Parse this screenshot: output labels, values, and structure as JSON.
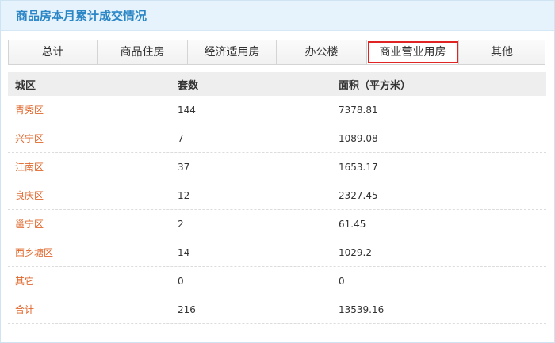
{
  "header": {
    "title": "商品房本月累计成交情况"
  },
  "tabs": [
    {
      "label": "总计",
      "active": false
    },
    {
      "label": "商品住房",
      "active": false
    },
    {
      "label": "经济适用房",
      "active": false
    },
    {
      "label": "办公楼",
      "active": false
    },
    {
      "label": "商业营业用房",
      "active": true
    },
    {
      "label": "其他",
      "active": false
    }
  ],
  "table": {
    "columns": [
      "城区",
      "套数",
      "面积（平方米）"
    ],
    "rows": [
      {
        "district": "青秀区",
        "units": "144",
        "area": "7378.81"
      },
      {
        "district": "兴宁区",
        "units": "7",
        "area": "1089.08"
      },
      {
        "district": "江南区",
        "units": "37",
        "area": "1653.17"
      },
      {
        "district": "良庆区",
        "units": "12",
        "area": "2327.45"
      },
      {
        "district": "邕宁区",
        "units": "2",
        "area": "61.45"
      },
      {
        "district": "西乡塘区",
        "units": "14",
        "area": "1029.2"
      },
      {
        "district": "其它",
        "units": "0",
        "area": "0"
      },
      {
        "district": "合计",
        "units": "216",
        "area": "13539.16"
      }
    ]
  },
  "colors": {
    "accent": "#2b86c6",
    "district_link": "#e0662a",
    "active_tab_border": "#e02424",
    "header_bg": "#e7f3fc"
  }
}
